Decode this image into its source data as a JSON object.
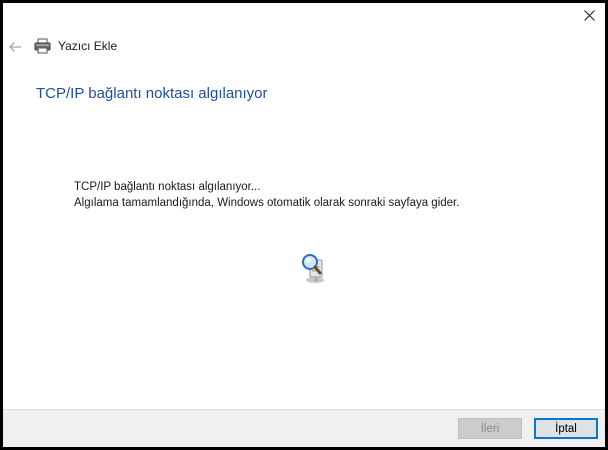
{
  "window": {
    "title": "Yazıcı Ekle"
  },
  "main": {
    "heading": "TCP/IP bağlantı noktası algılanıyor",
    "line1": "TCP/IP bağlantı noktası algılanıyor...",
    "line2": "Algılama tamamlandığında, Windows otomatik olarak sonraki sayfaya gider."
  },
  "footer": {
    "next_label": "İleri",
    "cancel_label": "İptal"
  },
  "icons": {
    "close": "close-icon",
    "back": "back-arrow-icon",
    "printer": "printer-icon",
    "detect": "network-search-icon"
  },
  "colors": {
    "heading": "#1e4f9c",
    "focus_border": "#0078d7"
  }
}
